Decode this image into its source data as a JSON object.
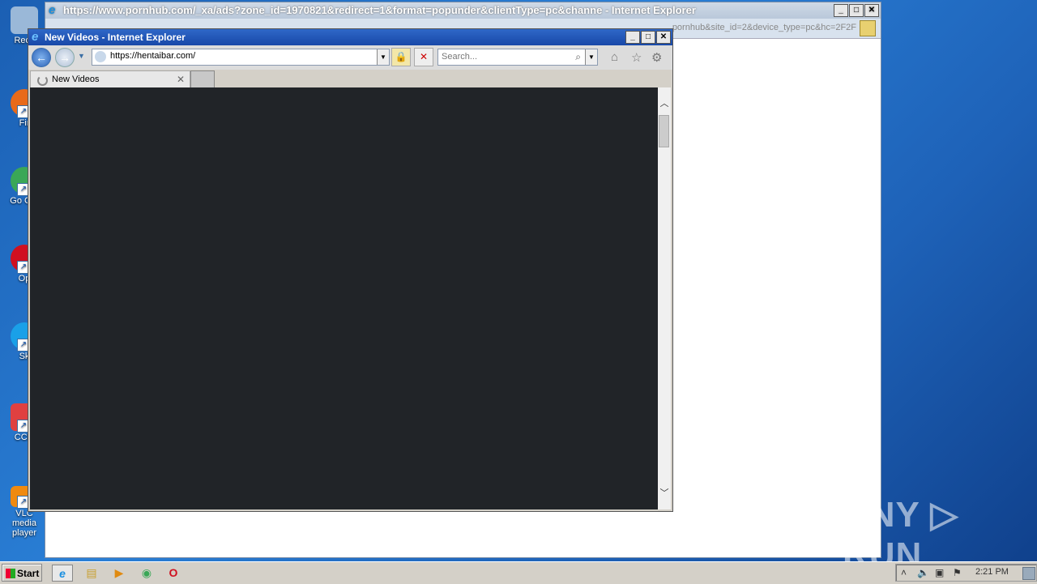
{
  "desktop": {
    "icons": [
      {
        "label": "Recy",
        "icon": "recycle-bin-icon",
        "color": "#9ab8d8"
      },
      {
        "label": "Fir",
        "icon": "firefox-icon",
        "color": "#e86a1a"
      },
      {
        "label": "Go Chr",
        "icon": "chrome-icon",
        "color": "#3aa757"
      },
      {
        "label": "Op",
        "icon": "opera-icon",
        "color": "#d01020"
      },
      {
        "label": "Sk",
        "icon": "skype-icon",
        "color": "#1aa0e8"
      },
      {
        "label": "CCle",
        "icon": "ccleaner-icon",
        "color": "#e04040"
      },
      {
        "label": "VLC media player",
        "icon": "vlc-icon",
        "color": "#f08a10"
      }
    ]
  },
  "back_window": {
    "title": "https://www.pornhub.com/_xa/ads?zone_id=1970821&redirect=1&format=popunder&clientType=pc&channe - Internet Explorer",
    "address_tail": "pornhub&site_id=2&device_type=pc&hc=2F2F"
  },
  "front_window": {
    "title": "New Videos - Internet Explorer",
    "url": "https://hentaibar.com/",
    "search_placeholder": "Search...",
    "tab_label": "New Videos",
    "content_color": "#212428"
  },
  "taskbar": {
    "start_label": "Start",
    "clock": "2:21 PM"
  },
  "watermark": "ANY ▷ RUN"
}
